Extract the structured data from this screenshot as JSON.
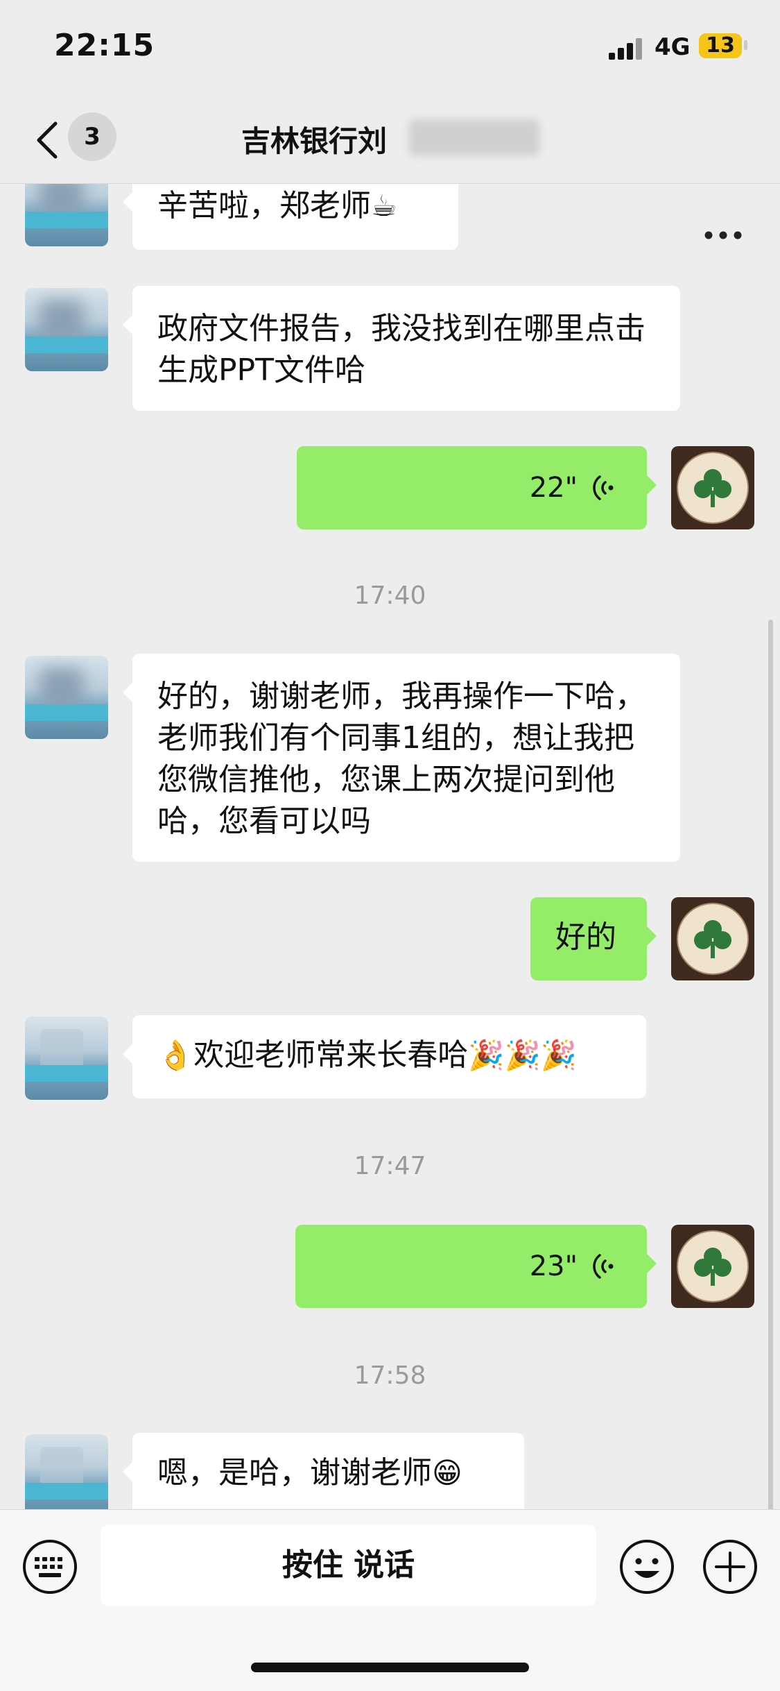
{
  "status_bar": {
    "time": "22:15",
    "network": "4G",
    "battery": "13"
  },
  "nav": {
    "badge": "3",
    "title": "吉林银行刘"
  },
  "messages": [
    {
      "type": "text",
      "from": "peer",
      "text": "辛苦啦，郑老师",
      "emoji": "☕"
    },
    {
      "type": "text",
      "from": "peer",
      "text": "政府文件报告，我没找到在哪里点击生成PPT文件哈"
    },
    {
      "type": "voice",
      "from": "self",
      "duration": "22\""
    },
    {
      "type": "time",
      "text": "17:40"
    },
    {
      "type": "text",
      "from": "peer",
      "text": "好的，谢谢老师，我再操作一下哈，老师我们有个同事1组的，想让我把您微信推他，您课上两次提问到他哈，您看可以吗"
    },
    {
      "type": "text",
      "from": "self",
      "text": "好的"
    },
    {
      "type": "text",
      "from": "peer",
      "text": "欢迎老师常来长春哈",
      "emoji_pre": "👌",
      "emoji_post": "🎉🎉🎉"
    },
    {
      "type": "time",
      "text": "17:47"
    },
    {
      "type": "voice",
      "from": "self",
      "duration": "23\""
    },
    {
      "type": "time",
      "text": "17:58"
    },
    {
      "type": "text",
      "from": "peer",
      "text": "嗯，是哈，谢谢老师",
      "emoji": "😁"
    }
  ],
  "input_bar": {
    "hold_to_talk": "按住 说话"
  },
  "colors": {
    "background": "#ededed",
    "self_bubble": "#95ec69",
    "peer_bubble": "#ffffff",
    "badge": "#f5c518"
  },
  "icons": [
    "back-icon",
    "more-icon",
    "voice-icon",
    "keyboard-icon",
    "emoji-icon",
    "plus-icon"
  ]
}
